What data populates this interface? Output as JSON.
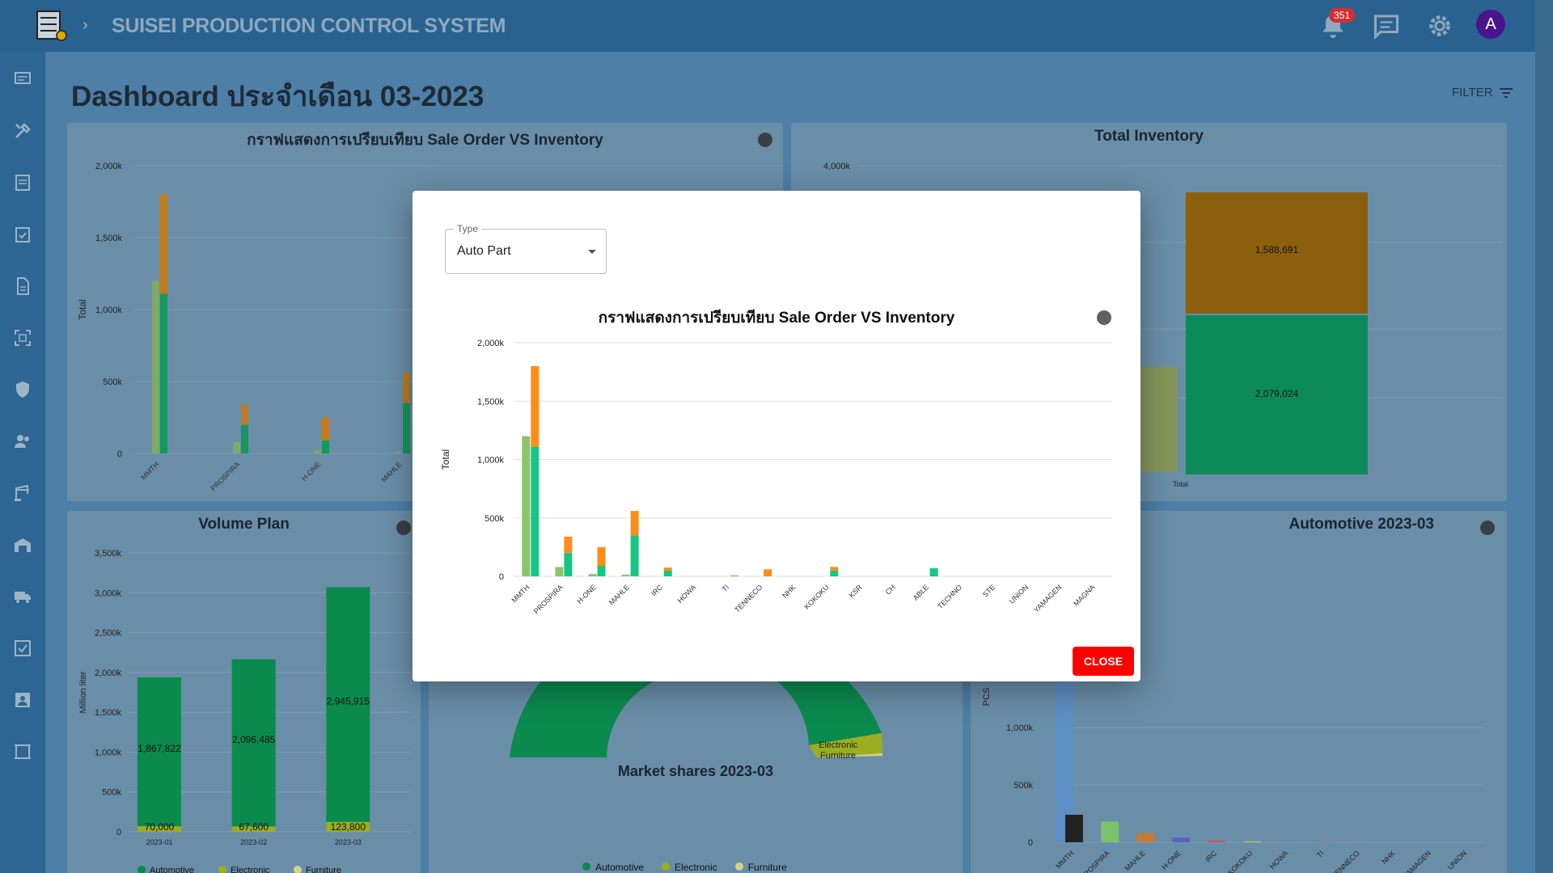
{
  "header": {
    "app_title": "SUISEI PRODUCTION CONTROL SYSTEM",
    "notifications_count": "351",
    "avatar_letter": "A"
  },
  "page": {
    "title": "Dashboard ประจำเดือน 03-2023",
    "filter_label": "FILTER"
  },
  "cards": {
    "so_vs_inv_title": "กราฟแสดงการเปรียบเทียบ Sale Order VS Inventory",
    "total_inventory_title": "Total Inventory",
    "volume_plan_title": "Volume Plan",
    "market_share_title": "Market shares 2023-03",
    "automotive_title": "Automotive 2023-03",
    "total_ylabel": "Total",
    "million_liter": "Million liter",
    "pcs": "PCS",
    "total_x": "Total",
    "inv_top_label": "1,588,691",
    "inv_bottom_label": "2,079,024",
    "electronic_label": "Electronic",
    "furniture_label": "Furniture"
  },
  "modal": {
    "type_label": "Type",
    "type_value": "Auto Part",
    "chart_title": "กราฟแสดงการเปรียบเทียบ Sale Order VS Inventory",
    "close_label": "CLOSE"
  },
  "colors": {
    "sale_order": "#8cc46b",
    "inventory": "#16c784",
    "orange": "#ff8c1a",
    "dark_green": "#0b8a4e",
    "olive": "#9aae1f",
    "beige": "#d7d08a"
  },
  "chart_data": [
    {
      "id": "modal-chart",
      "type": "bar",
      "title": "กราฟแสดงการเปรียบเทียบ Sale Order VS Inventory",
      "ylabel": "Total",
      "ylim": [
        0,
        2000000
      ],
      "yticks": [
        "0",
        "500k",
        "1,000k",
        "1,500k",
        "2,000k"
      ],
      "categories": [
        "MMTH",
        "PROSPIRA",
        "H-ONE",
        "MAHLE",
        "IRC",
        "HOWA",
        "TI",
        "TENNECO",
        "NHK",
        "KOKOKU",
        "KSR",
        "CH",
        "ABLE",
        "TECHNO",
        "STE",
        "UNION",
        "YAMAGEN",
        "MAGNA"
      ],
      "series": [
        {
          "values": [
            1200000,
            80000,
            20000,
            15000,
            0,
            0,
            0,
            0,
            0,
            0,
            0,
            0,
            0,
            0,
            0,
            0,
            0,
            0
          ]
        },
        {
          "values": [
            1110000,
            200000,
            90000,
            350000,
            50000,
            0,
            0,
            0,
            0,
            50000,
            0,
            0,
            70000,
            0,
            0,
            0,
            0,
            0
          ]
        },
        {
          "values": [
            690000,
            140000,
            160000,
            210000,
            25000,
            0,
            8000,
            60000,
            0,
            30000,
            0,
            0,
            0,
            0,
            0,
            0,
            0,
            0
          ]
        }
      ]
    },
    {
      "id": "bg-so-inv",
      "type": "bar",
      "ylabel": "Total",
      "ylim": [
        0,
        2000000
      ],
      "yticks": [
        "0",
        "500k",
        "1,000k",
        "1,500k",
        "2,000k"
      ],
      "categories": [
        "MMTH",
        "PROSPIRA",
        "H-ONE",
        "MAHLE",
        "IRC",
        "HOWA",
        "TI",
        "TENNECO"
      ],
      "series": [
        {
          "values": [
            1200000,
            80000,
            20000,
            15000,
            0,
            0,
            0,
            0
          ]
        },
        {
          "values": [
            1110000,
            200000,
            90000,
            350000,
            50000,
            0,
            0,
            0
          ]
        },
        {
          "values": [
            690000,
            140000,
            160000,
            210000,
            25000,
            0,
            8000,
            60000
          ]
        }
      ]
    },
    {
      "id": "volume-plan",
      "type": "bar",
      "ylabel": "Million liter",
      "ylim": [
        0,
        3500000
      ],
      "yticks": [
        "0",
        "500k",
        "1,000k",
        "1,500k",
        "2,000k",
        "2,500k",
        "3,000k",
        "3,500k"
      ],
      "categories": [
        "2023-01",
        "2023-02",
        "2023-03"
      ],
      "series": [
        {
          "name": "Automotive",
          "values": [
            1867822,
            2096485,
            2945915
          ]
        },
        {
          "name": "Electronic",
          "values": [
            70000,
            67600,
            123800
          ]
        },
        {
          "name": "Furniture",
          "values": [
            0,
            0,
            0
          ]
        }
      ],
      "labels_auto": [
        "1,867,822",
        "2,096,485",
        "2,945,915"
      ],
      "labels_elec": [
        "70,000",
        "67,600",
        "123,800"
      ]
    },
    {
      "id": "automotive",
      "type": "bar",
      "ylabel": "PCS",
      "ylim": [
        0,
        1000000
      ],
      "yticks": [
        "0",
        "500k",
        "1,000k"
      ],
      "categories": [
        "MMTH",
        "PROSPIRA",
        "MAHLE",
        "H-ONE",
        "IRC",
        "KOKOKU",
        "HOWA",
        "TI",
        "TENNECO",
        "NHK",
        "YAMAGEN",
        "UNION"
      ],
      "values": [
        240000,
        180000,
        80000,
        40000,
        15000,
        8000,
        5000,
        3000,
        2000,
        0,
        0,
        0
      ]
    }
  ],
  "legend_volume": [
    "Automotive",
    "Electronic",
    "Furniture"
  ],
  "legend_market": [
    "Automotive",
    "Electronic",
    "Furniture"
  ]
}
